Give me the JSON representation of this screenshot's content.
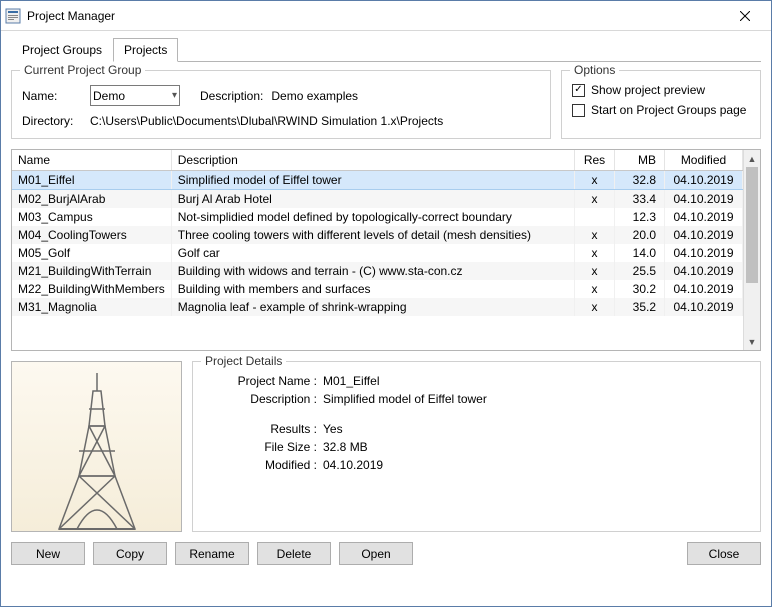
{
  "window": {
    "title": "Project Manager"
  },
  "tabs": {
    "groups": "Project Groups",
    "projects": "Projects"
  },
  "current_group": {
    "legend": "Current Project Group",
    "name_label": "Name:",
    "name_value": "Demo",
    "desc_label": "Description:",
    "desc_value": "Demo examples",
    "dir_label": "Directory:",
    "dir_value": "C:\\Users\\Public\\Documents\\Dlubal\\RWIND Simulation 1.x\\Projects"
  },
  "options": {
    "legend": "Options",
    "preview_label": "Show project preview",
    "preview_checked": "✓",
    "startpage_label": "Start on Project Groups page",
    "startpage_checked": ""
  },
  "headers": {
    "name": "Name",
    "desc": "Description",
    "res": "Res",
    "mb": "MB",
    "mod": "Modified"
  },
  "rows": [
    {
      "name": "M01_Eiffel",
      "desc": "Simplified model of Eiffel tower",
      "res": "x",
      "mb": "32.8",
      "mod": "04.10.2019"
    },
    {
      "name": "M02_BurjAlArab",
      "desc": "Burj Al Arab Hotel",
      "res": "x",
      "mb": "33.4",
      "mod": "04.10.2019"
    },
    {
      "name": "M03_Campus",
      "desc": "Not-simplidied model defined by topologically-correct boundary",
      "res": "",
      "mb": "12.3",
      "mod": "04.10.2019"
    },
    {
      "name": "M04_CoolingTowers",
      "desc": "Three cooling towers with different levels of detail (mesh densities)",
      "res": "x",
      "mb": "20.0",
      "mod": "04.10.2019"
    },
    {
      "name": "M05_Golf",
      "desc": "Golf car",
      "res": "x",
      "mb": "14.0",
      "mod": "04.10.2019"
    },
    {
      "name": "M21_BuildingWithTerrain",
      "desc": "Building with widows and terrain - (C) www.sta-con.cz",
      "res": "x",
      "mb": "25.5",
      "mod": "04.10.2019"
    },
    {
      "name": "M22_BuildingWithMembers",
      "desc": "Building with members and surfaces",
      "res": "x",
      "mb": "30.2",
      "mod": "04.10.2019"
    },
    {
      "name": "M31_Magnolia",
      "desc": "Magnolia leaf - example of shrink-wrapping",
      "res": "x",
      "mb": "35.2",
      "mod": "04.10.2019"
    }
  ],
  "details": {
    "legend": "Project Details",
    "pname_l": "Project Name :",
    "pname_v": "M01_Eiffel",
    "desc_l": "Description :",
    "desc_v": "Simplified model of Eiffel tower",
    "res_l": "Results :",
    "res_v": "Yes",
    "size_l": "File Size :",
    "size_v": "32.8 MB",
    "mod_l": "Modified :",
    "mod_v": "04.10.2019"
  },
  "buttons": {
    "new": "New",
    "copy": "Copy",
    "rename": "Rename",
    "delete": "Delete",
    "open": "Open",
    "close": "Close"
  }
}
